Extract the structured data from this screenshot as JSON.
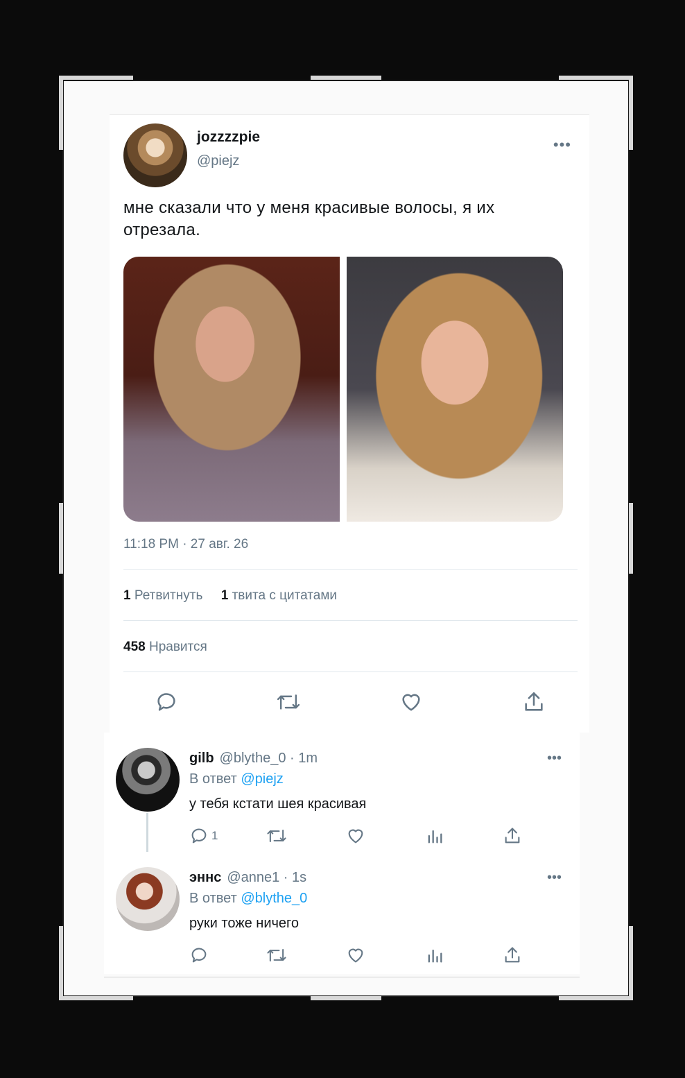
{
  "tweet": {
    "display_name": "jozzzzpie",
    "handle": "@piejz",
    "more": "•••",
    "text": "мне сказали что у меня красивые волосы, я их отрезала.",
    "timestamp": "11:18 PM · 27 авг. 26",
    "stats": {
      "retweets_count": "1",
      "retweets_label": "Ретвитнуть",
      "quotes_count": "1",
      "quotes_label": "твита с цитатами",
      "likes_count": "458",
      "likes_label": "Нравится"
    },
    "actions": [
      {
        "icon": "reply-icon"
      },
      {
        "icon": "retweet-icon"
      },
      {
        "icon": "like-icon"
      },
      {
        "icon": "share-icon"
      }
    ]
  },
  "replies": [
    {
      "display_name": "gilb",
      "meta": "@blythe_0 · 1m",
      "reply_prefix": "В ответ",
      "reply_to": "@piejz",
      "text": "у тебя кстати шея красивая",
      "reply_count": "1",
      "more": "•••"
    },
    {
      "display_name": "эннс",
      "meta": "@anne1 · 1s",
      "reply_prefix": "В ответ",
      "reply_to": "@blythe_0",
      "text": "руки тоже ничего",
      "reply_count": "",
      "more": "•••"
    }
  ],
  "colors": {
    "link": "#1da1f2",
    "secondary_text": "#657786",
    "primary_text": "#14171a",
    "frame_background": "#0b0b0b"
  }
}
